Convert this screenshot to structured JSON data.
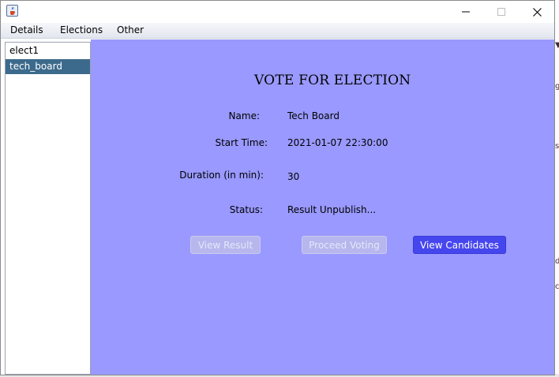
{
  "menu": {
    "items": [
      "Details",
      "Elections",
      "Other"
    ]
  },
  "elections_list": {
    "items": [
      "elect1",
      "tech_board"
    ],
    "selected": "tech_board"
  },
  "election": {
    "title": "VOTE FOR ELECTION",
    "name_label": "Name:",
    "name_value": "Tech Board",
    "start_label": "Start Time:",
    "start_value": "2021-01-07 22:30:00",
    "duration_label": "Duration (in min):",
    "duration_value": "30",
    "status_label": "Status:",
    "status_value": "Result Unpublish..."
  },
  "buttons": {
    "view_result": "View Result",
    "proceed_voting": "Proceed Voting",
    "view_candidates": "View Candidates"
  },
  "colors": {
    "panel_bg": "#9999ff",
    "primary_button": "#4646ee",
    "selected_row": "#3c6a8c"
  },
  "icons": {
    "app": "java-cup-icon",
    "minimize": "minimize-icon",
    "maximize": "maximize-icon",
    "close": "close-icon"
  }
}
